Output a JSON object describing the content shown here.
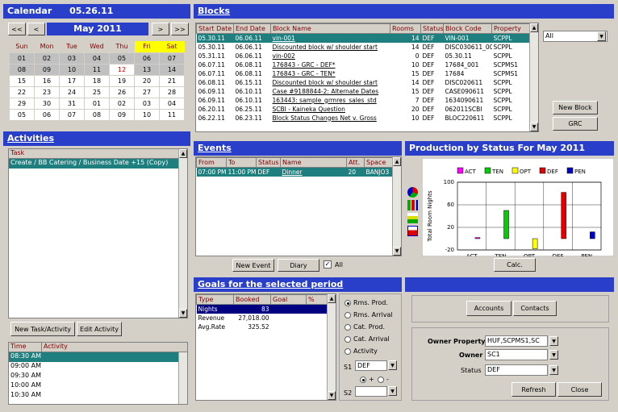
{
  "calendar": {
    "title": "Calendar",
    "date": "05.26.11",
    "month": "May 2011",
    "nav_prev2": "<<",
    "nav_prev": "<",
    "nav_next": ">",
    "nav_next2": ">>",
    "days": [
      "Sun",
      "Mon",
      "Tue",
      "Wed",
      "Thu",
      "Fri",
      "Sat"
    ],
    "weeks": [
      [
        "01",
        "02",
        "03",
        "04",
        "05",
        "06",
        "07"
      ],
      [
        "08",
        "09",
        "10",
        "11",
        "12",
        "13",
        "14"
      ],
      [
        "15",
        "16",
        "17",
        "18",
        "19",
        "20",
        "21"
      ],
      [
        "22",
        "23",
        "24",
        "25",
        "26",
        "27",
        "28"
      ],
      [
        "29",
        "30",
        "31",
        "01",
        "02",
        "03",
        "04"
      ],
      [
        "05",
        "06",
        "07",
        "08",
        "09",
        "10",
        "11"
      ]
    ]
  },
  "blocks": {
    "title": "Blocks",
    "columns": [
      "Start Date",
      "End Date",
      "Block Name",
      "Rooms",
      "Status",
      "Block Code",
      "Property"
    ],
    "rows": [
      [
        "05.30.11",
        "06.06.11",
        "vin-001",
        "14",
        "DEF",
        "VIN-001",
        "SCPPL"
      ],
      [
        "05.30.11",
        "06.06.11",
        "Discounted block w/ shoulder start",
        "14",
        "DEF",
        "DISC030611_001",
        "SCPPL"
      ],
      [
        "05.31.11",
        "06.06.11",
        "vin-002",
        "0",
        "DEF",
        "05.30.11",
        "SCPPL"
      ],
      [
        "06.07.11",
        "06.08.11",
        "176843 - GRC - DEF*",
        "10",
        "DEF",
        "17684_001",
        "SCPMS1"
      ],
      [
        "06.07.11",
        "06.08.11",
        "176843 - GRC - TEN*",
        "15",
        "DEF",
        "17684",
        "SCPMS1"
      ],
      [
        "06.08.11",
        "06.15.11",
        "Discounted block w/ shoulder start",
        "14",
        "DEF",
        "DISC020611",
        "SCPPL"
      ],
      [
        "06.09.11",
        "06.10.11",
        "Case #9188844-2: Alternate Dates",
        "15",
        "DEF",
        "CASE090611",
        "SCPPL"
      ],
      [
        "06.09.11",
        "06.10.11",
        "163443: sample_grmres_sales_std",
        "7",
        "DEF",
        "1634090611",
        "SCPPL"
      ],
      [
        "06.20.11",
        "06.25.11",
        "SCBI - Kaineka Question",
        "20",
        "DEF",
        "062011SCBI",
        "SCPPL"
      ],
      [
        "06.22.11",
        "06.23.11",
        "Block Status Changes Net v. Gross",
        "10",
        "DEF",
        "BLOC220611",
        "SCPPL"
      ]
    ],
    "filter_value": "All",
    "new_block_label": "New Block",
    "grc_label": "GRC"
  },
  "activities": {
    "title": "Activities",
    "task_header": "Task",
    "tasks": [
      "Create / BB Catering / Business Date +15 (Copy)"
    ],
    "new_label": "New Task/Activity",
    "edit_label": "Edit Activity",
    "time_header": "Time",
    "activity_header": "Activity",
    "times": [
      "08:30 AM",
      "09:00 AM",
      "09:30 AM",
      "10:00 AM",
      "10:30 AM"
    ]
  },
  "events": {
    "title": "Events",
    "columns": [
      "From",
      "To",
      "Status",
      "Name",
      "Att.",
      "Space"
    ],
    "rows": [
      [
        "07:00 PM",
        "11:00 PM",
        "DEF",
        "Dinner",
        "20",
        "BANJO3"
      ]
    ],
    "new_label": "New Event",
    "diary_label": "Diary",
    "all_label": "All"
  },
  "production": {
    "title": "Production by Status For May 2011",
    "calc_label": "Calc."
  },
  "chart_data": {
    "type": "bar",
    "categories": [
      "ACT",
      "TEN",
      "OPT",
      "DEF",
      "PEN"
    ],
    "values": [
      2,
      50,
      -18,
      82,
      12
    ],
    "ylabel": "Total Room Nights",
    "yticks": [
      100,
      60,
      20,
      -20
    ],
    "ylim": [
      -20,
      100
    ],
    "colors": [
      "#ff00ff",
      "#00d000",
      "#ffff00",
      "#e00000",
      "#0000c0"
    ],
    "legend": [
      "ACT",
      "TEN",
      "OPT",
      "DEF",
      "PEN"
    ]
  },
  "goals": {
    "title": "Goals for the selected period",
    "columns": [
      "Type",
      "Booked",
      "Goal",
      "%"
    ],
    "rows": [
      [
        "Nights",
        "83",
        "",
        ""
      ],
      [
        "Revenue",
        "27,018.00",
        "",
        ""
      ],
      [
        "Avg.Rate",
        "325.52",
        "",
        ""
      ]
    ],
    "options": [
      "Rms. Prod.",
      "Rms. Arrival",
      "Cat. Prod.",
      "Cat. Arrival",
      "Activity"
    ],
    "s1_label": "S1",
    "s1_value": "DEF",
    "s2_label": "S2",
    "plus": "+",
    "minus": "-"
  },
  "filters": {
    "accounts_label": "Accounts",
    "contacts_label": "Contacts",
    "owner_property_label": "Owner Property",
    "owner_property_value": "HUF,SCPMS1,SC",
    "owner_label": "Owner",
    "owner_value": "SC1",
    "status_label": "Status",
    "status_value": "DEF",
    "refresh_label": "Refresh",
    "close_label": "Close"
  }
}
